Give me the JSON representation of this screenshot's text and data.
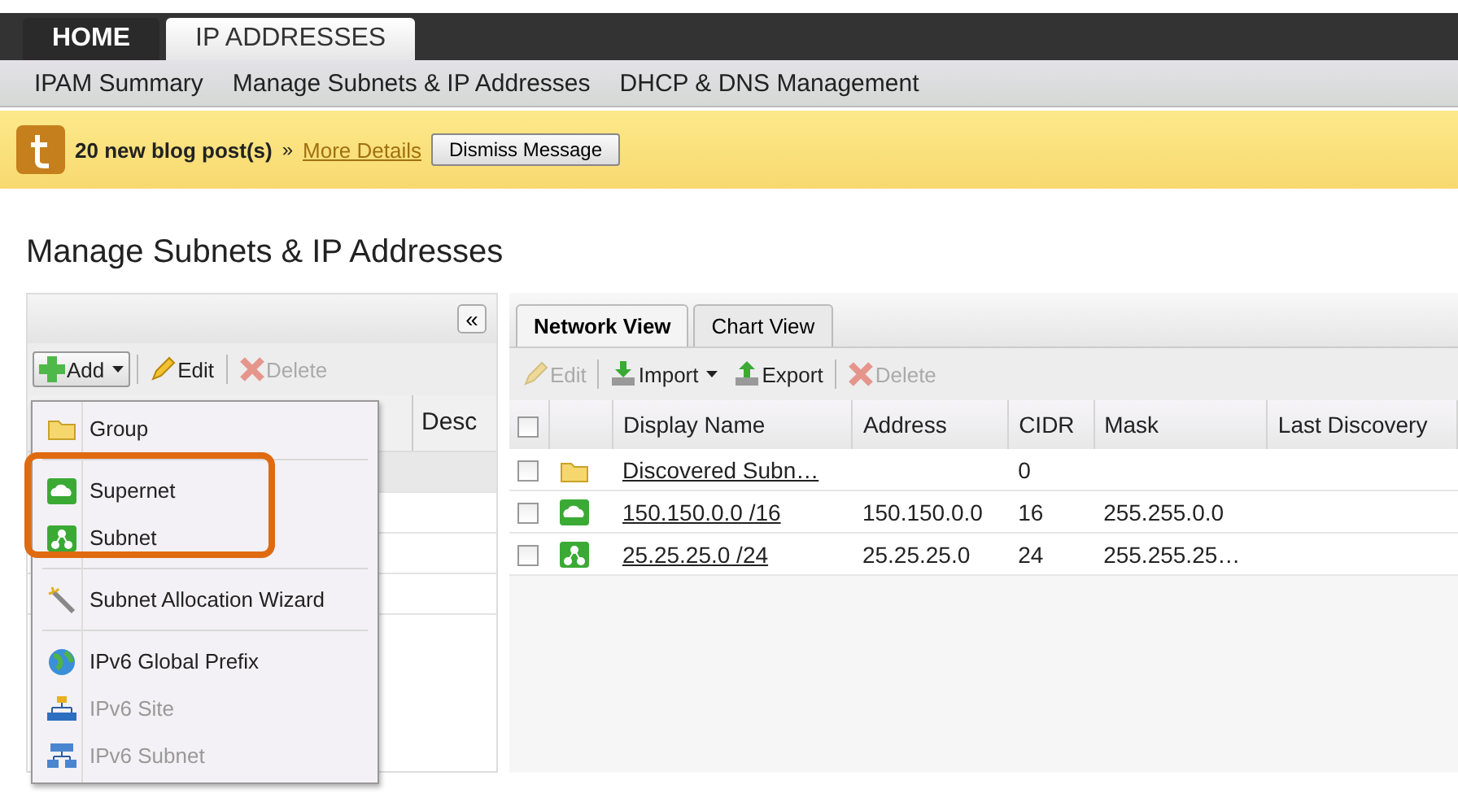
{
  "top_tabs": [
    {
      "label": "HOME",
      "selected": false
    },
    {
      "label": "IP ADDRESSES",
      "selected": true
    }
  ],
  "sub_nav": [
    "IPAM Summary",
    "Manage Subnets & IP Addresses",
    "DHCP & DNS Management"
  ],
  "banner": {
    "message": "20 new blog post(s)",
    "separator": "»",
    "link": "More Details",
    "button": "Dismiss Message"
  },
  "page_title": "Manage Subnets & IP Addresses",
  "left_panel": {
    "collapse": "«",
    "toolbar": [
      {
        "kind": "add",
        "label": "Add",
        "disabled": false
      },
      {
        "kind": "edit",
        "label": "Edit",
        "disabled": false
      },
      {
        "kind": "delete",
        "label": "Delete",
        "disabled": true
      }
    ],
    "column_2": "Desc"
  },
  "add_menu": {
    "highlighted": true,
    "sections": [
      [
        {
          "kind": "group",
          "label": "Group",
          "disabled": false
        }
      ],
      [
        {
          "kind": "supernet",
          "label": "Supernet",
          "disabled": false
        },
        {
          "kind": "subnet",
          "label": "Subnet",
          "disabled": false
        }
      ],
      [
        {
          "kind": "wizard",
          "label": "Subnet Allocation Wizard",
          "disabled": false
        }
      ],
      [
        {
          "kind": "globe",
          "label": "IPv6 Global Prefix",
          "disabled": false
        },
        {
          "kind": "site",
          "label": "IPv6 Site",
          "disabled": true
        },
        {
          "kind": "v6subnet",
          "label": "IPv6 Subnet",
          "disabled": true
        }
      ]
    ]
  },
  "view_tabs": [
    {
      "label": "Network View",
      "selected": true
    },
    {
      "label": "Chart View",
      "selected": false
    }
  ],
  "right_toolbar": [
    {
      "kind": "edit",
      "label": "Edit",
      "disabled": true
    },
    {
      "kind": "import",
      "label": "Import",
      "disabled": false
    },
    {
      "kind": "export",
      "label": "Export",
      "disabled": false
    },
    {
      "kind": "delete",
      "label": "Delete",
      "disabled": true
    }
  ],
  "table": {
    "select_all_checked": false,
    "columns": [
      "Display Name",
      "Address",
      "CIDR",
      "Mask",
      "Last Discovery"
    ],
    "rows": [
      {
        "kind": "group",
        "checked": false,
        "cells": [
          "Discovered Subn…",
          "",
          "0",
          "",
          ""
        ]
      },
      {
        "kind": "supernet",
        "checked": false,
        "cells": [
          "150.150.0.0 /16",
          "150.150.0.0",
          "16",
          "255.255.0.0",
          ""
        ]
      },
      {
        "kind": "subnet",
        "checked": false,
        "cells": [
          "25.25.25.0 /24",
          "25.25.25.0",
          "24",
          "255.255.25…",
          ""
        ]
      }
    ]
  }
}
